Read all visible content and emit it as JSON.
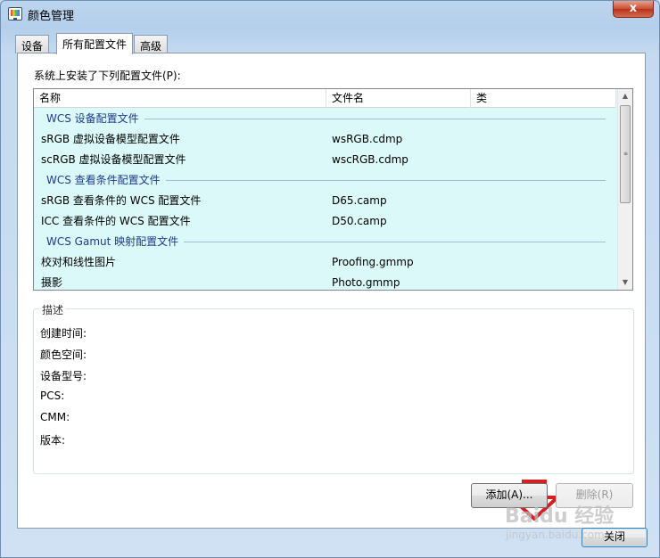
{
  "window": {
    "title": "颜色管理",
    "close_glyph": "x"
  },
  "tabs": [
    {
      "label": "设备",
      "active": false
    },
    {
      "label": "所有配置文件",
      "active": true
    },
    {
      "label": "高级",
      "active": false
    }
  ],
  "profiles": {
    "section_label": "系统上安装了下列配置文件(P):",
    "columns": [
      "名称",
      "文件名",
      "类"
    ],
    "groups": [
      {
        "title": "WCS 设备配置文件",
        "items": [
          {
            "name": "sRGB 虚拟设备模型配置文件",
            "file": "wsRGB.cdmp"
          },
          {
            "name": "scRGB 虚拟设备模型配置文件",
            "file": "wscRGB.cdmp"
          }
        ]
      },
      {
        "title": "WCS 查看条件配置文件",
        "items": [
          {
            "name": "sRGB 查看条件的 WCS 配置文件",
            "file": "D65.camp"
          },
          {
            "name": "ICC 查看条件的 WCS 配置文件",
            "file": "D50.camp"
          }
        ]
      },
      {
        "title": "WCS Gamut 映射配置文件",
        "items": [
          {
            "name": "校对和线性图片",
            "file": "Proofing.gmmp"
          },
          {
            "name": "摄影",
            "file": "Photo.gmmp"
          }
        ]
      }
    ]
  },
  "description": {
    "legend": "描述",
    "fields": [
      "创建时间:",
      "颜色空间:",
      "设备型号:",
      "PCS:",
      "CMM:",
      "版本:"
    ]
  },
  "buttons": {
    "add": "添加(A)...",
    "remove": "删除(R)",
    "close": "关闭"
  },
  "watermark": {
    "brand": "Baidu 经验",
    "url": "jingyan.baidu.com"
  },
  "colors": {
    "list_bg": "#dcf9f9",
    "group_title": "#1e3a8a",
    "annotation_arrow": "#d42020"
  },
  "icons": [
    "color-management-icon",
    "close-icon",
    "scroll-up-icon",
    "scroll-down-icon",
    "down-arrow-annotation-icon"
  ]
}
